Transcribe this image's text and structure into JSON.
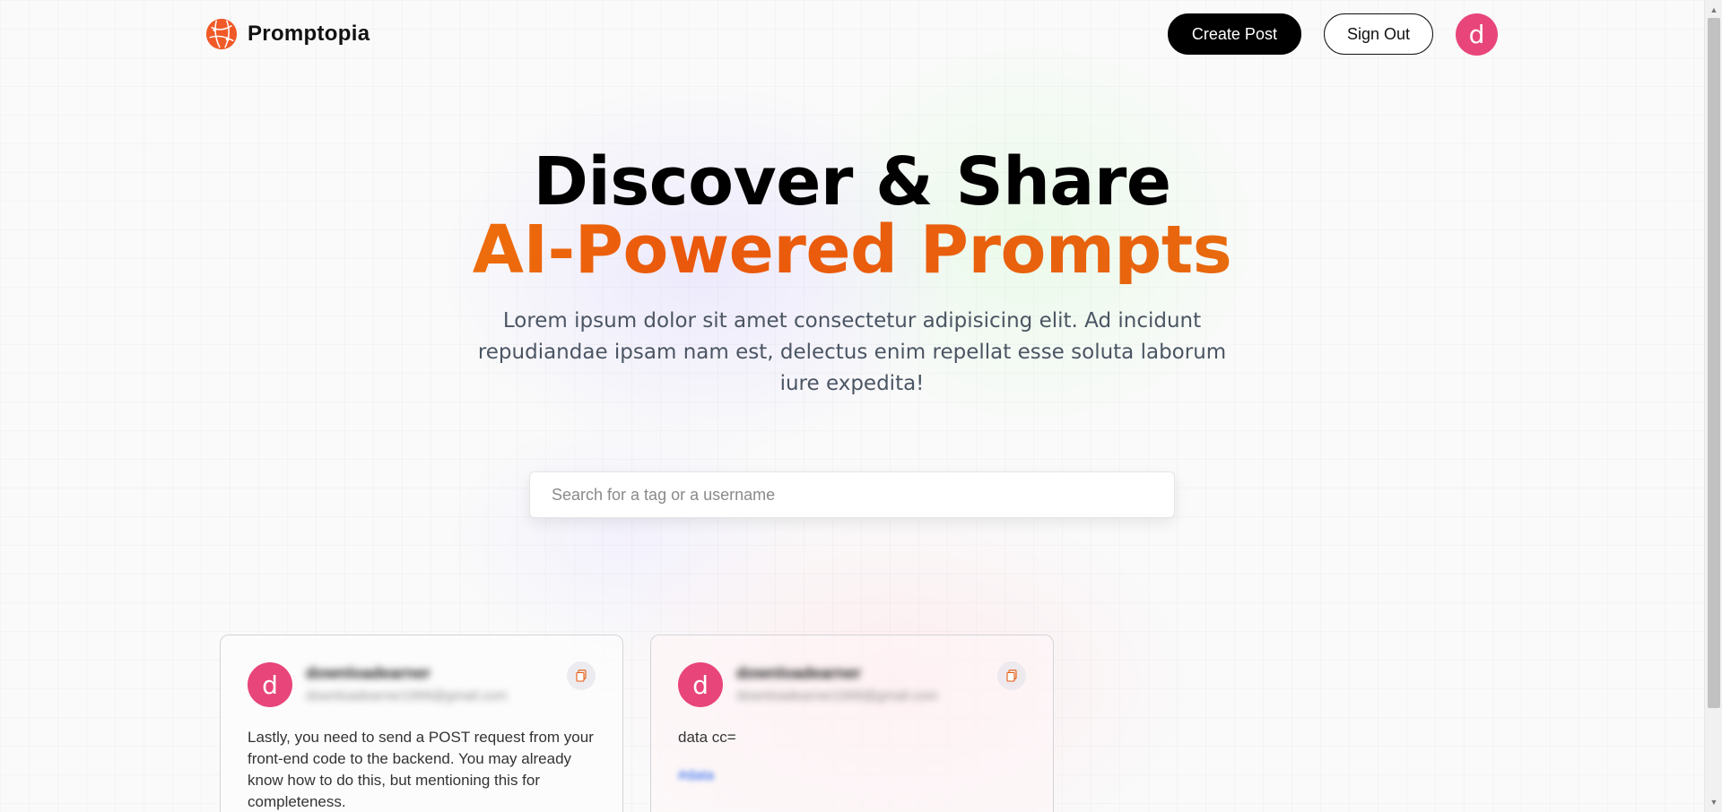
{
  "brand": {
    "name": "Promptopia",
    "logo_icon": "globe-logo-icon"
  },
  "nav": {
    "create_post": "Create Post",
    "sign_out": "Sign Out",
    "avatar_letter": "d"
  },
  "hero": {
    "title_line1": "Discover & Share",
    "title_line2": "AI-Powered Prompts",
    "description": "Lorem ipsum dolor sit amet consectetur adipisicing elit. Ad incidunt repudiandae ipsam nam est, delectus enim repellat esse soluta laborum iure expedita!"
  },
  "search": {
    "placeholder": "Search for a tag or a username",
    "value": ""
  },
  "cards": [
    {
      "avatar_letter": "d",
      "username": "downloadearner",
      "email": "downloadearner1999@gmail.com",
      "text": "Lastly, you need to send a POST request from your front-end code to the backend. You may already know how to do this, but mentioning this for completeness.",
      "tag": ""
    },
    {
      "avatar_letter": "d",
      "username": "downloadearner",
      "email": "downloadearner1999@gmail.com",
      "text": "data cc=",
      "tag": "#data"
    }
  ],
  "colors": {
    "accent_orange": "#ea580c",
    "accent_amber": "#f59e0b",
    "avatar_pink": "#e8457a",
    "button_black": "#000000"
  }
}
